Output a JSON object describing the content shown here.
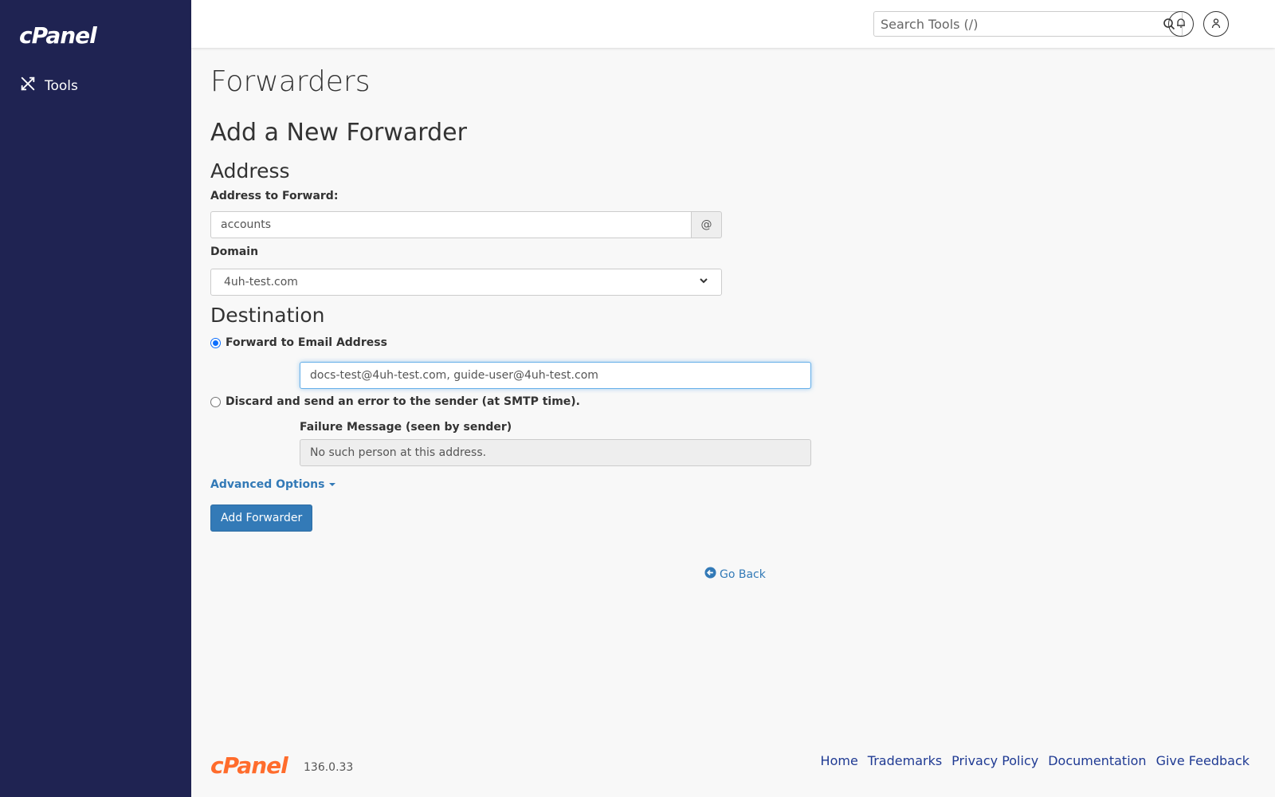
{
  "sidebar": {
    "logo": "cPanel",
    "items": [
      {
        "label": "Tools"
      }
    ]
  },
  "header": {
    "search_placeholder": "Search Tools (/)"
  },
  "page": {
    "title": "Forwarders",
    "section_title": "Add a New Forwarder",
    "address_heading": "Address",
    "address_label": "Address to Forward:",
    "address_value": "accounts",
    "address_addon": "@",
    "domain_label": "Domain",
    "domain_value": "4uh-test.com",
    "destination_heading": "Destination",
    "forward_radio_label": "Forward to Email Address",
    "forward_value": "docs-test@4uh-test.com, guide-user@4uh-test.com",
    "discard_radio_label": "Discard and send an error to the sender (at SMTP time).",
    "failure_label": "Failure Message (seen by sender)",
    "failure_value": "No such person at this address.",
    "advanced_options": "Advanced Options",
    "add_button": "Add Forwarder",
    "go_back": "Go Back"
  },
  "footer": {
    "logo": "cPanel",
    "version": "136.0.33",
    "links": [
      "Home",
      "Trademarks",
      "Privacy Policy",
      "Documentation",
      "Give Feedback"
    ]
  },
  "colors": {
    "sidebar_bg": "#1f2352",
    "link": "#337ab7",
    "primary": "#337ab7",
    "footer_logo": "#ff6c2c"
  }
}
